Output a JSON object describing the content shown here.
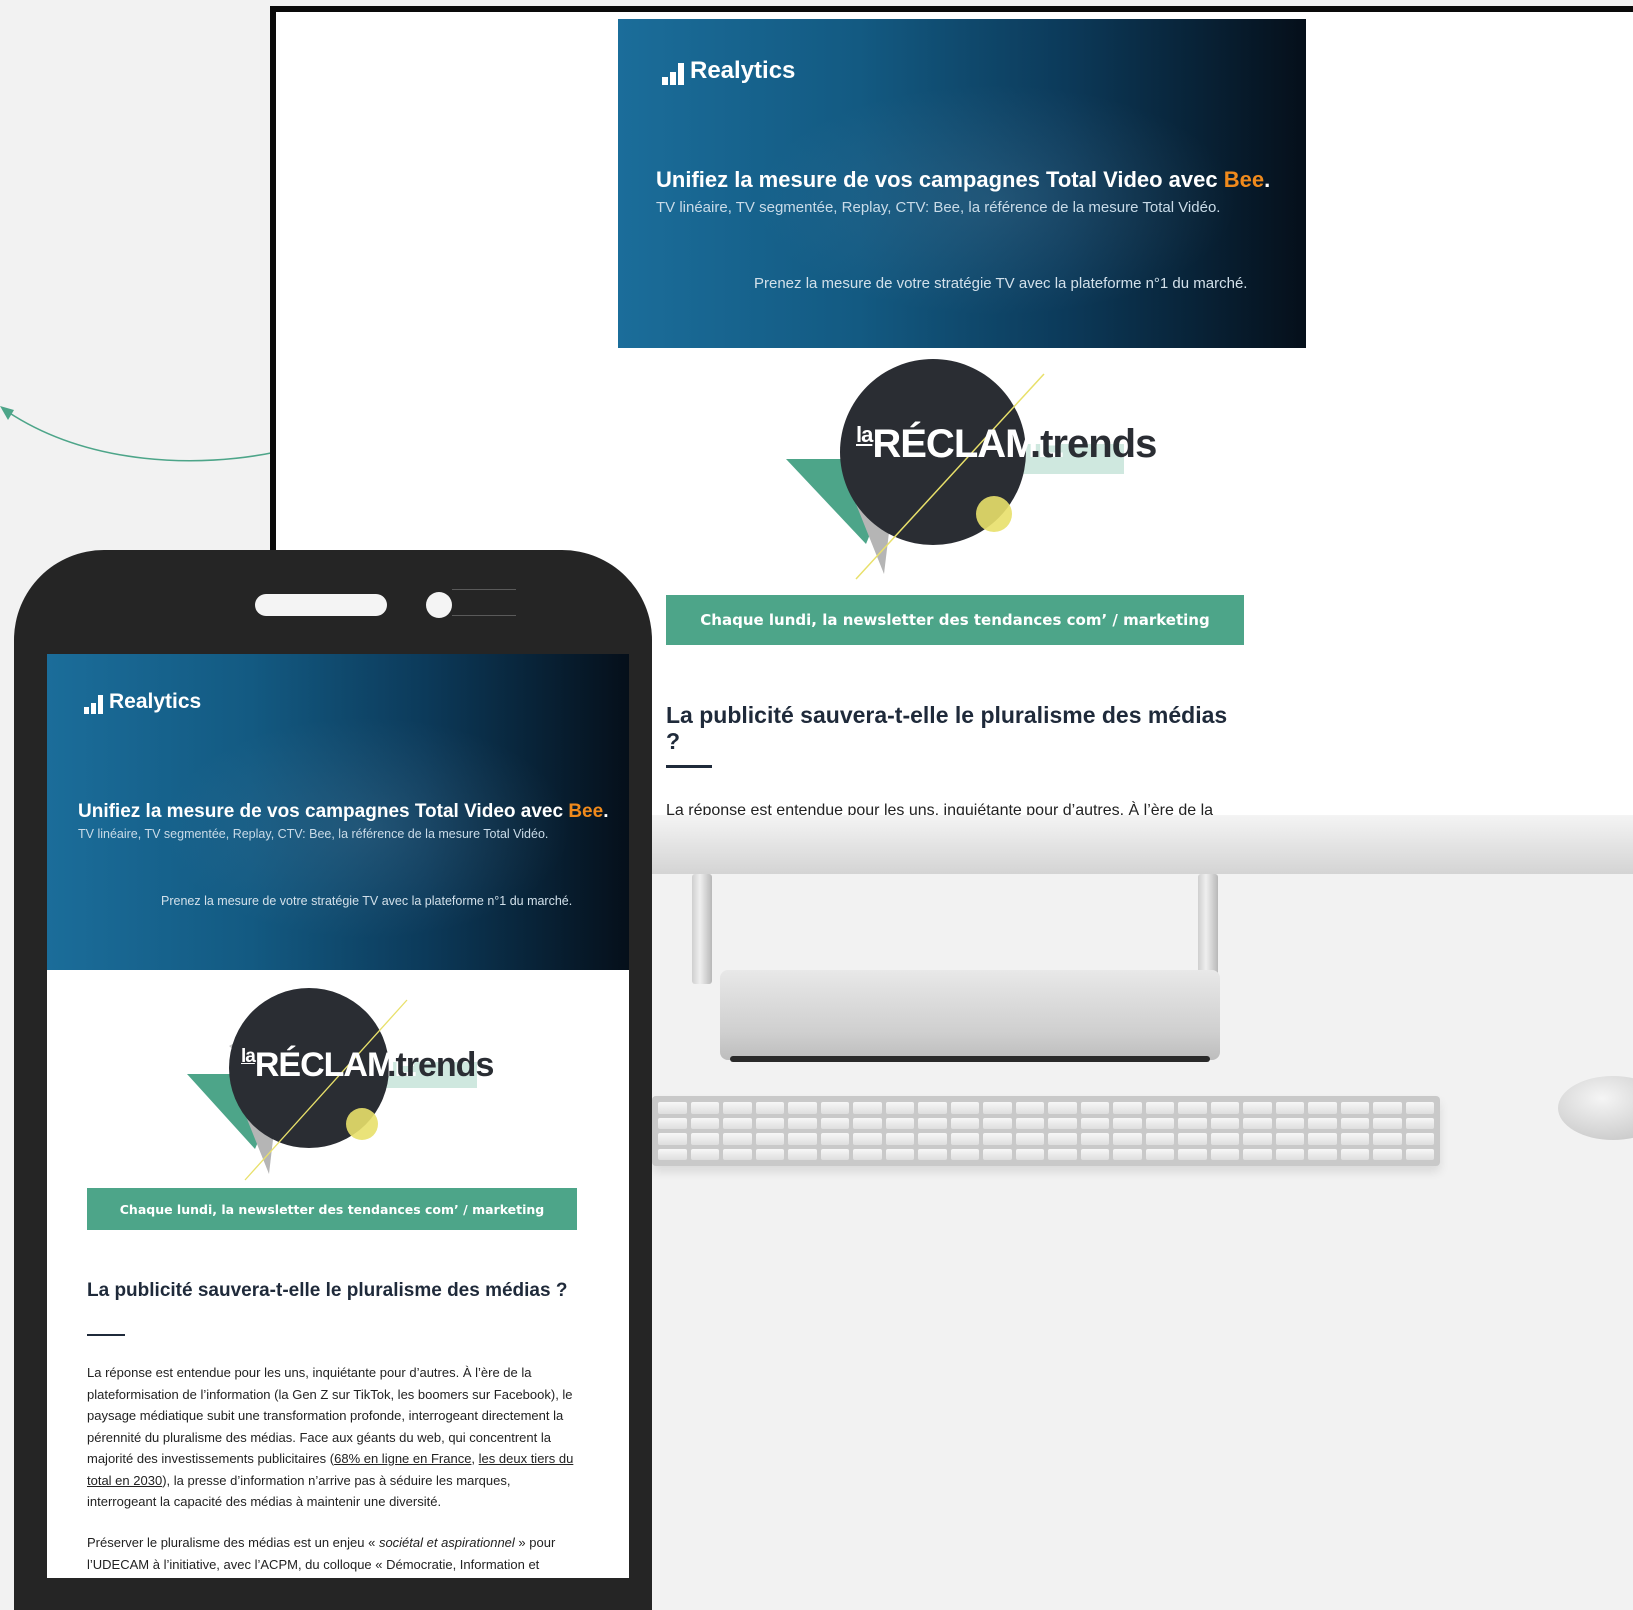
{
  "newsletter": {
    "banner": {
      "brand": "Realytics",
      "headline_pre": "Unifiez la mesure de vos campagnes Total Video avec ",
      "headline_accent": "Bee",
      "headline_post": ".",
      "sub": "TV linéaire, TV segmentée, Replay, CTV: Bee, la référence de la mesure Total Vidéo.",
      "cta": "Prenez la mesure de votre stratégie TV avec la plateforme n°1 du marché."
    },
    "logo": {
      "prefix": "la",
      "word": "RÉCLAME",
      "suffix": ".trends"
    },
    "tagline": "Chaque lundi, la newsletter des tendances com’ / marketing",
    "article": {
      "title": "La publicité sauvera-t-elle le pluralisme des médias ?",
      "p1_a": "La réponse est entendue pour les uns, inquiétante pour d’autres. À l’ère de la plateformisation de l’information (la Gen Z sur TikTok, les boomers sur Facebook), le paysage médiatique subit une transformation profonde, interrogeant directement la pérennité du pluralisme des médias. Face aux géants du web, qui concentrent la majorité des investissements publicitaires (",
      "p1_link1": "68% en ligne en France",
      "p1_sep": ", ",
      "p1_link2": "les deux tiers du total en 2030",
      "p1_b": "), la presse d’information n’arrive pas à séduire les marques, interrogeant la capacité des médias à maintenir une diversité.",
      "desktop_p1": "La réponse est entendue pour les uns, inquiétante pour d’autres. À l’ère de la",
      "p2_a": "Préserver le pluralisme des médias est un enjeu « ",
      "p2_em": "sociétal et aspirationnel",
      "p2_b": " » pour l’UDECAM à l’initiative, avec l’ACPM, du colloque « Démocratie, Information et"
    }
  },
  "colors": {
    "accent_green": "#4da589",
    "accent_orange": "#f08a1c",
    "title_navy": "#1f2a3a",
    "logo_circle": "#2a2d33",
    "logo_yellow": "#e8e06a"
  },
  "icons": [
    "bar-chart-logo-icon",
    "speaker-grille",
    "front-camera"
  ]
}
